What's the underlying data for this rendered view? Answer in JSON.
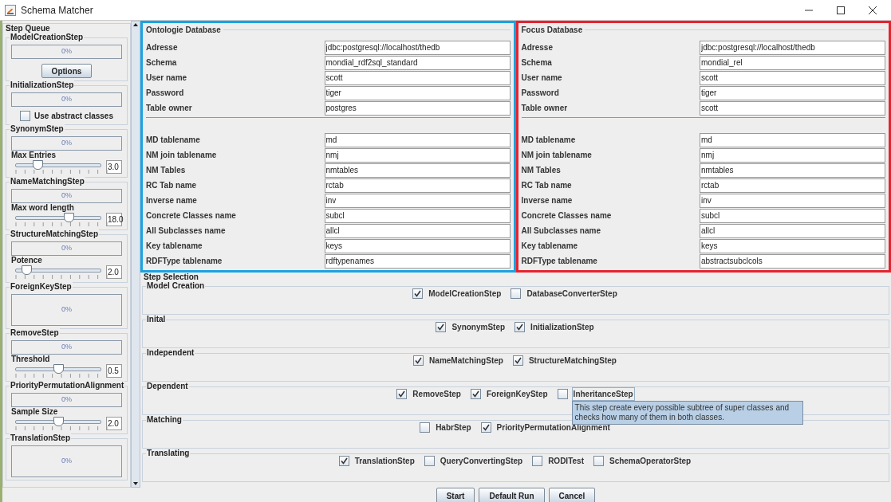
{
  "window": {
    "title": "Schema Matcher"
  },
  "step_queue": {
    "title": "Step Queue",
    "steps": [
      {
        "name": "ModelCreationStep",
        "progress": "0%",
        "level": 0,
        "kind": "button",
        "button": "Options"
      },
      {
        "name": "InitializationStep",
        "progress": "0%",
        "level": 0,
        "kind": "checkbox",
        "checkbox": {
          "label": "Use abstract classes",
          "checked": false
        }
      },
      {
        "name": "SynonymStep",
        "progress": "0%",
        "level": 0,
        "kind": "slider",
        "slider": {
          "label": "Max Entries",
          "level": 0.25,
          "value": "3.0"
        }
      },
      {
        "name": "NameMatchingStep",
        "progress": "0%",
        "level": 0,
        "kind": "slider",
        "slider": {
          "label": "Max word length",
          "level": 0.62,
          "value": "18.0"
        }
      },
      {
        "name": "StructureMatchingStep",
        "progress": "0%",
        "level": 0,
        "kind": "slider",
        "slider": {
          "label": "Potence",
          "level": 0.12,
          "value": "2.0"
        }
      },
      {
        "name": "ForeignKeyStep",
        "progress": "0%",
        "level": 0,
        "kind": "tall"
      },
      {
        "name": "RemoveStep",
        "progress": "0%",
        "level": 0,
        "kind": "slider",
        "slider": {
          "label": "Threshold",
          "level": 0.5,
          "value": "0.5"
        }
      },
      {
        "name": "PriorityPermutationAlignment",
        "progress": "0%",
        "level": 0,
        "kind": "slider",
        "slider": {
          "label": "Sample Size",
          "level": 0.5,
          "value": "2.0"
        }
      },
      {
        "name": "TranslationStep",
        "progress": "0%",
        "level": 0,
        "kind": "tall"
      }
    ]
  },
  "databases": [
    {
      "title": "Ontologie Database",
      "color": "#1aa3e0",
      "groups": [
        [
          {
            "label": "Adresse",
            "value": "jdbc:postgresql://localhost/thedb"
          },
          {
            "label": "Schema",
            "value": "mondial_rdf2sql_standard"
          },
          {
            "label": "User name",
            "value": "scott"
          },
          {
            "label": "Password",
            "value": "tiger"
          },
          {
            "label": "Table owner",
            "value": "postgres"
          }
        ],
        [
          {
            "label": "MD tablename",
            "value": "md"
          },
          {
            "label": "NM join tablename",
            "value": "nmj"
          },
          {
            "label": "NM Tables",
            "value": "nmtables"
          },
          {
            "label": "RC Tab name",
            "value": "rctab"
          },
          {
            "label": "Inverse name",
            "value": "inv"
          },
          {
            "label": "Concrete Classes name",
            "value": "subcl"
          },
          {
            "label": "All Subclasses name",
            "value": "allcl"
          },
          {
            "label": "Key tablename",
            "value": "keys"
          },
          {
            "label": "RDFType tablename",
            "value": "rdftypenames"
          }
        ]
      ]
    },
    {
      "title": "Focus Database",
      "color": "#e52330",
      "groups": [
        [
          {
            "label": "Adresse",
            "value": "jdbc:postgresql://localhost/thedb"
          },
          {
            "label": "Schema",
            "value": "mondial_rel"
          },
          {
            "label": "User name",
            "value": "scott"
          },
          {
            "label": "Password",
            "value": "tiger"
          },
          {
            "label": "Table owner",
            "value": "scott"
          }
        ],
        [
          {
            "label": "MD tablename",
            "value": "md"
          },
          {
            "label": "NM join tablename",
            "value": "nmj"
          },
          {
            "label": "NM Tables",
            "value": "nmtables"
          },
          {
            "label": "RC Tab name",
            "value": "rctab"
          },
          {
            "label": "Inverse name",
            "value": "inv"
          },
          {
            "label": "Concrete Classes name",
            "value": "subcl"
          },
          {
            "label": "All Subclasses name",
            "value": "allcl"
          },
          {
            "label": "Key tablename",
            "value": "keys"
          },
          {
            "label": "RDFType tablename",
            "value": "abstractsubclcols"
          }
        ]
      ]
    }
  ],
  "step_selection": {
    "title": "Step Selection",
    "groups": [
      {
        "title": "Model Creation",
        "options": [
          {
            "label": "ModelCreationStep",
            "checked": true,
            "focused": false
          },
          {
            "label": "DatabaseConverterStep",
            "checked": false,
            "focused": false
          }
        ]
      },
      {
        "title": "Inital",
        "options": [
          {
            "label": "SynonymStep",
            "checked": true,
            "focused": false
          },
          {
            "label": "InitializationStep",
            "checked": true,
            "focused": false
          }
        ]
      },
      {
        "title": "Independent",
        "options": [
          {
            "label": "NameMatchingStep",
            "checked": true,
            "focused": false
          },
          {
            "label": "StructureMatchingStep",
            "checked": true,
            "focused": false
          }
        ]
      },
      {
        "title": "Dependent",
        "options": [
          {
            "label": "RemoveStep",
            "checked": true,
            "focused": false
          },
          {
            "label": "ForeignKeyStep",
            "checked": true,
            "focused": false
          },
          {
            "label": "InheritanceStep",
            "checked": false,
            "focused": true,
            "tooltip": "This step create every possible subtree of super classes and checks how many of them in both classes."
          }
        ]
      },
      {
        "title": "Matching",
        "options": [
          {
            "label": "HabrStep",
            "checked": false,
            "focused": false
          },
          {
            "label": "PriorityPermutationAlignment",
            "checked": true,
            "focused": false
          }
        ]
      },
      {
        "title": "Translating",
        "options": [
          {
            "label": "TranslationStep",
            "checked": true,
            "focused": false
          },
          {
            "label": "QueryConvertingStep",
            "checked": false,
            "focused": false
          },
          {
            "label": "RODITest",
            "checked": false,
            "focused": false
          },
          {
            "label": "SchemaOperatorStep",
            "checked": false,
            "focused": false
          }
        ]
      }
    ]
  },
  "buttons": [
    "Start",
    "Default Run",
    "Cancel"
  ]
}
